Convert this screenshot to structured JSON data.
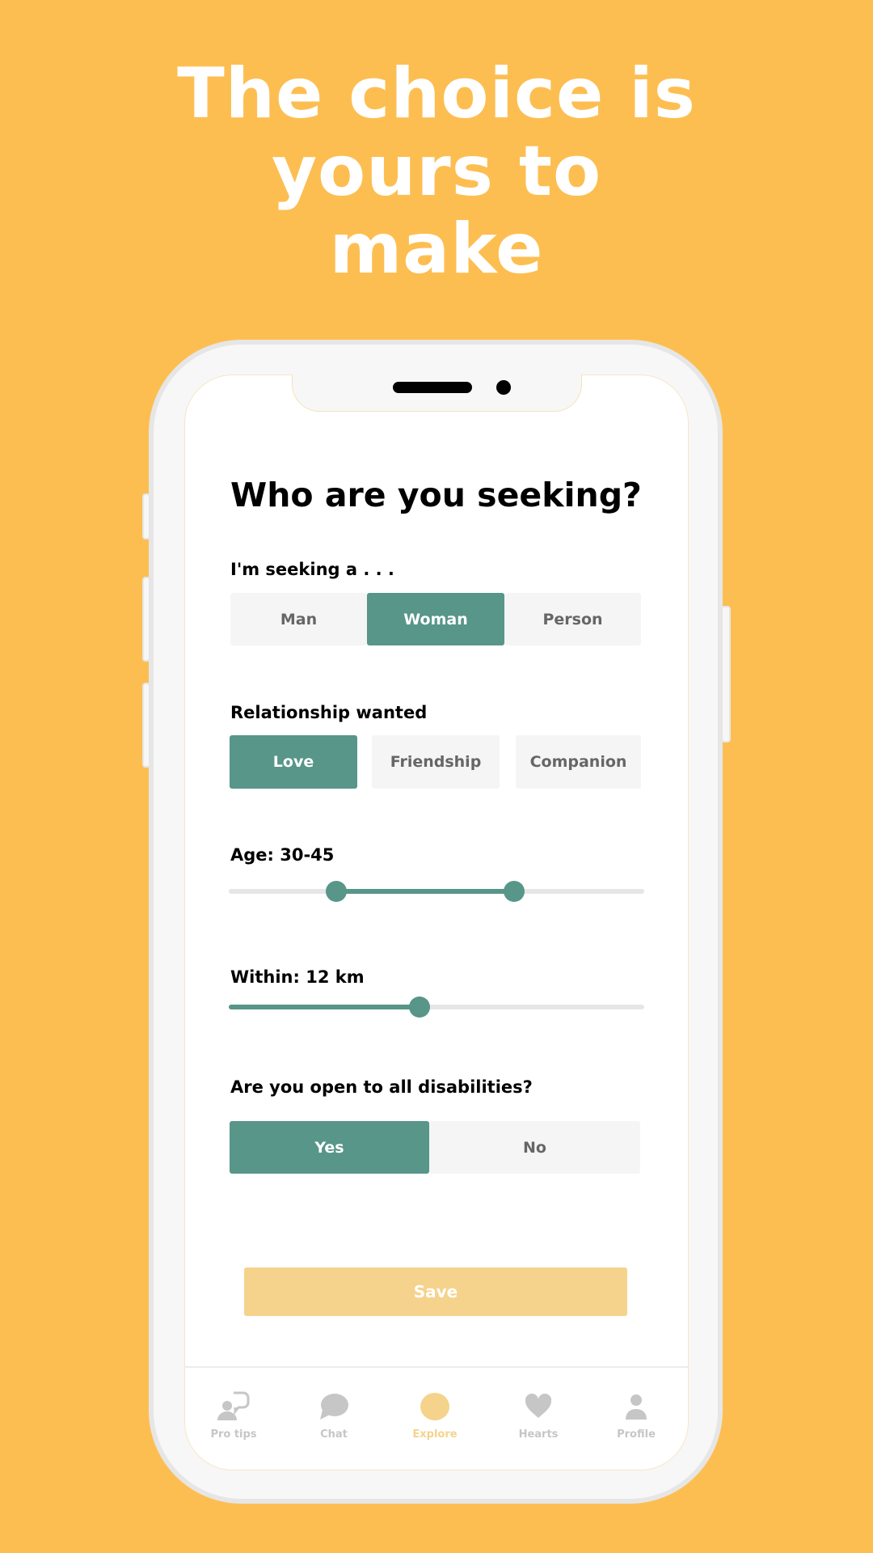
{
  "headline": [
    "The choice is",
    "yours to",
    "make"
  ],
  "colors": {
    "background": "#FDBE51",
    "accent": "#579689",
    "save": "#F5D38C"
  },
  "screen": {
    "title": "Who are you seeking?",
    "seeking": {
      "label": "I'm seeking a . . .",
      "options": [
        "Man",
        "Woman",
        "Person"
      ],
      "selected": "Woman"
    },
    "relationship": {
      "label": "Relationship wanted",
      "options": [
        "Love",
        "Friendship",
        "Companion"
      ],
      "selected": "Love"
    },
    "age": {
      "label": "Age: 30-45",
      "min": 30,
      "max": 45
    },
    "distance": {
      "label": "Within: 12 km",
      "value_km": 12
    },
    "disabilities": {
      "label": "Are you open to all disabilities?",
      "options": [
        "Yes",
        "No"
      ],
      "selected": "Yes"
    },
    "save_label": "Save"
  },
  "nav": [
    {
      "label": "Pro tips",
      "icon": "pro-tips-icon"
    },
    {
      "label": "Chat",
      "icon": "chat-icon"
    },
    {
      "label": "Explore",
      "icon": "explore-icon",
      "active": true
    },
    {
      "label": "Hearts",
      "icon": "heart-icon"
    },
    {
      "label": "Profile",
      "icon": "profile-icon"
    }
  ]
}
